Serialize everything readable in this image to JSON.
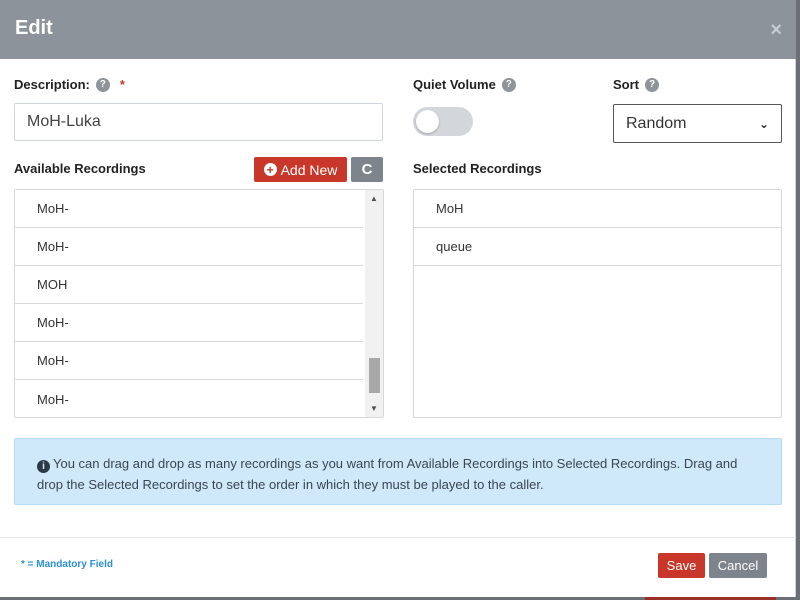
{
  "header": {
    "title": "Edit",
    "close_glyph": "×"
  },
  "description": {
    "label": "Description:",
    "required_mark": "*",
    "value": "MoH-Luka",
    "help_icon": "question-circle-icon"
  },
  "quiet_volume": {
    "label": "Quiet Volume",
    "enabled": false,
    "help_icon": "question-circle-icon"
  },
  "sort": {
    "label": "Sort",
    "selected": "Random",
    "help_icon": "question-circle-icon"
  },
  "available": {
    "label": "Available Recordings",
    "add_new_label": "Add New",
    "refresh_glyph": "C",
    "items": [
      "MoH-",
      "MoH-",
      "MOH",
      "MoH-",
      "MoH-",
      "MoH-"
    ]
  },
  "selected": {
    "label": "Selected Recordings",
    "items": [
      "MoH",
      "queue"
    ]
  },
  "info": {
    "text": "You can drag and drop as many recordings as you want from Available Recordings into Selected Recordings. Drag and drop the Selected Recordings to set the order in which they must be played to the caller."
  },
  "footer": {
    "mandatory_note": "* = Mandatory Field",
    "save_label": "Save",
    "cancel_label": "Cancel"
  },
  "colors": {
    "header_bg": "#8c939b",
    "primary_red": "#c8372a",
    "secondary_gray": "#7d848c",
    "info_bg": "#cfe9fb",
    "link_blue": "#2a8fd6"
  }
}
